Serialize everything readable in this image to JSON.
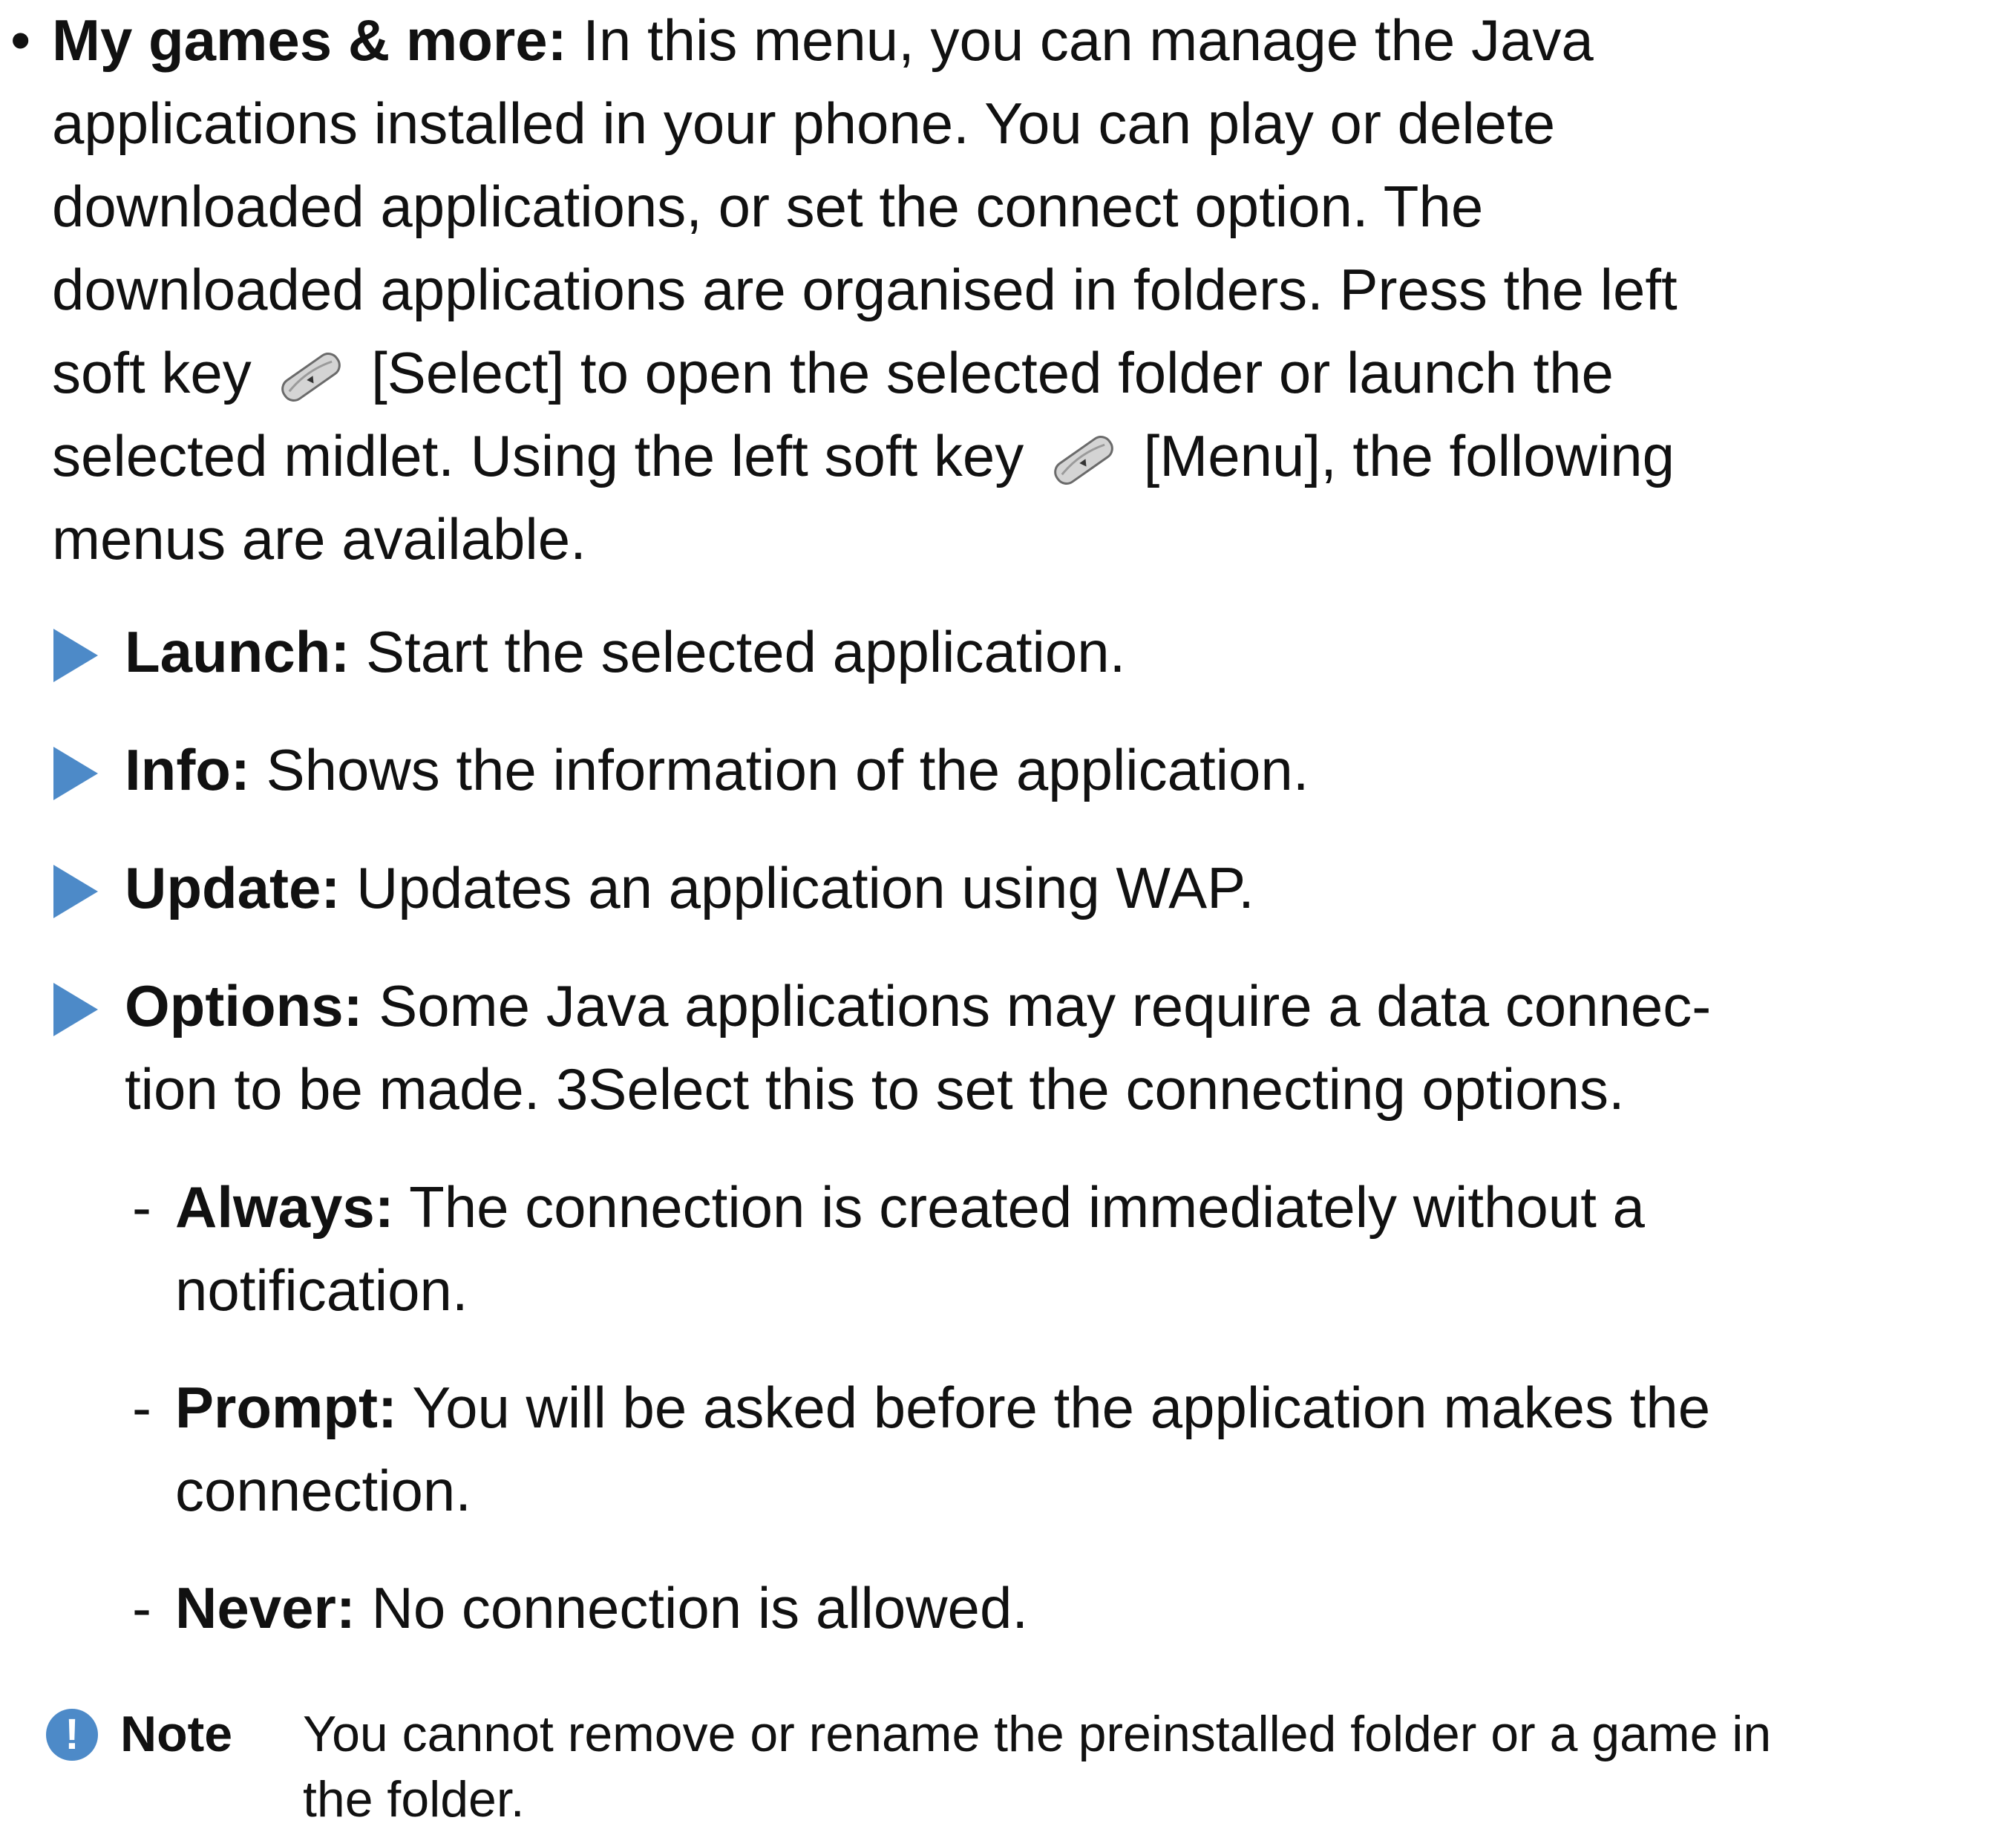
{
  "section": {
    "bullet": "•",
    "title": "My games & more:",
    "lines": [
      "In this menu, you can manage the Java",
      "applications installed in your phone. You can play or delete",
      "downloaded applications, or set the connect option. The",
      "downloaded applications are organised in folders. Press the left"
    ],
    "line5_a": "soft key",
    "line5_b": "[Select] to open the selected folder or launch the",
    "line6_a": "selected midlet. Using the left soft key",
    "line6_b": "[Menu], the following",
    "line7": "menus are available."
  },
  "items": [
    {
      "label": "Launch:",
      "lines": [
        "Start the selected application."
      ]
    },
    {
      "label": "Info:",
      "lines": [
        "Shows the information of the application."
      ]
    },
    {
      "label": "Update:",
      "lines": [
        "Updates an application using WAP."
      ]
    },
    {
      "label": "Options:",
      "lines": [
        "Some Java applications may require a data connec-",
        "tion to be made. 3Select this to set the connecting options."
      ]
    }
  ],
  "suboptions": [
    {
      "dash": "-",
      "label": "Always:",
      "lines": [
        "The connection is created immediately without a",
        "notification."
      ]
    },
    {
      "dash": "-",
      "label": "Prompt:",
      "lines": [
        "You will be asked before the application makes the",
        "connection."
      ]
    },
    {
      "dash": "-",
      "label": "Never:",
      "lines": [
        "No connection is allowed."
      ]
    }
  ],
  "note": {
    "icon_symbol": "!",
    "label": "Note",
    "lines": [
      "You cannot remove or rename the preinstalled folder or a game in",
      "the folder."
    ]
  },
  "colors": {
    "accent": "#4d8ac8",
    "text": "#111111"
  },
  "icons": {
    "softkey": "left-soft-key-icon",
    "triangle": "triangle-bullet-icon",
    "note": "note-exclamation-icon"
  }
}
